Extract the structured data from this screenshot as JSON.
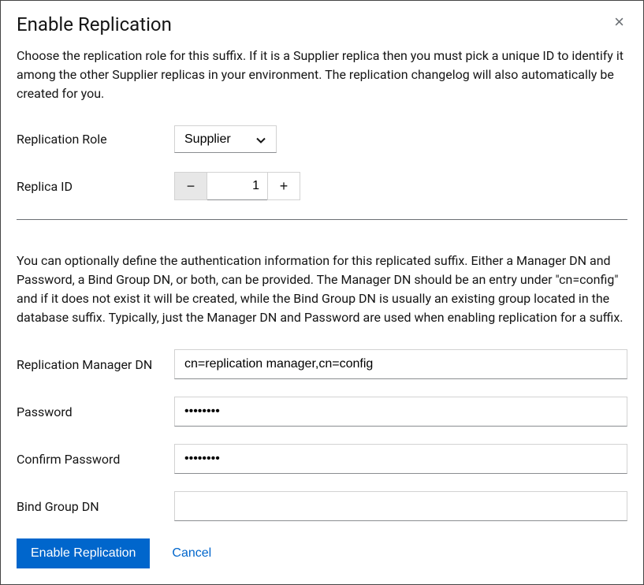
{
  "dialog": {
    "title": "Enable Replication",
    "description1": "Choose the replication role for this suffix. If it is a Supplier replica then you must pick a unique ID to identify it among the other Supplier replicas in your environment. The replication changelog will also automatically be created for you.",
    "description2": "You can optionally define the authentication information for this replicated suffix. Either a Manager DN and Password, a Bind Group DN, or both, can be provided. The Manager DN should be an entry under \"cn=config\" and if it does not exist it will be created, while the Bind Group DN is usually an existing group located in the database suffix. Typically, just the Manager DN and Password are used when enabling replication for a suffix."
  },
  "fields": {
    "replicationRole": {
      "label": "Replication Role",
      "value": "Supplier"
    },
    "replicaId": {
      "label": "Replica ID",
      "value": "1"
    },
    "managerDn": {
      "label": "Replication Manager DN",
      "value": "cn=replication manager,cn=config"
    },
    "password": {
      "label": "Password",
      "value": "••••••••"
    },
    "confirmPassword": {
      "label": "Confirm Password",
      "value": "••••••••"
    },
    "bindGroupDn": {
      "label": "Bind Group DN",
      "value": ""
    }
  },
  "buttons": {
    "submit": "Enable Replication",
    "cancel": "Cancel"
  }
}
